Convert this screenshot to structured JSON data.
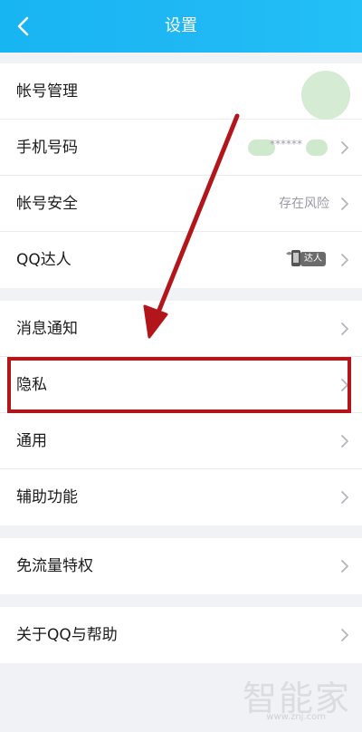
{
  "header": {
    "title": "设置",
    "back_icon": "chevron-left-icon"
  },
  "groups": [
    {
      "items": [
        {
          "label": "帐号管理",
          "value": ""
        },
        {
          "label": "手机号码",
          "value": "******"
        },
        {
          "label": "帐号安全",
          "value": "存在风险"
        },
        {
          "label": "QQ达人",
          "value": "达人"
        }
      ]
    },
    {
      "items": [
        {
          "label": "消息通知"
        },
        {
          "label": "隐私"
        },
        {
          "label": "通用"
        },
        {
          "label": "辅助功能"
        }
      ]
    },
    {
      "items": [
        {
          "label": "免流量特权"
        }
      ]
    },
    {
      "items": [
        {
          "label": "关于QQ与帮助"
        }
      ]
    }
  ],
  "watermark": {
    "brand": "智能家",
    "url": "www.znj.com"
  },
  "colors": {
    "header_bg": "#18b5f3",
    "annotation_red": "#b3161a",
    "page_bg": "#f1f2f6",
    "row_bg": "#ffffff"
  }
}
